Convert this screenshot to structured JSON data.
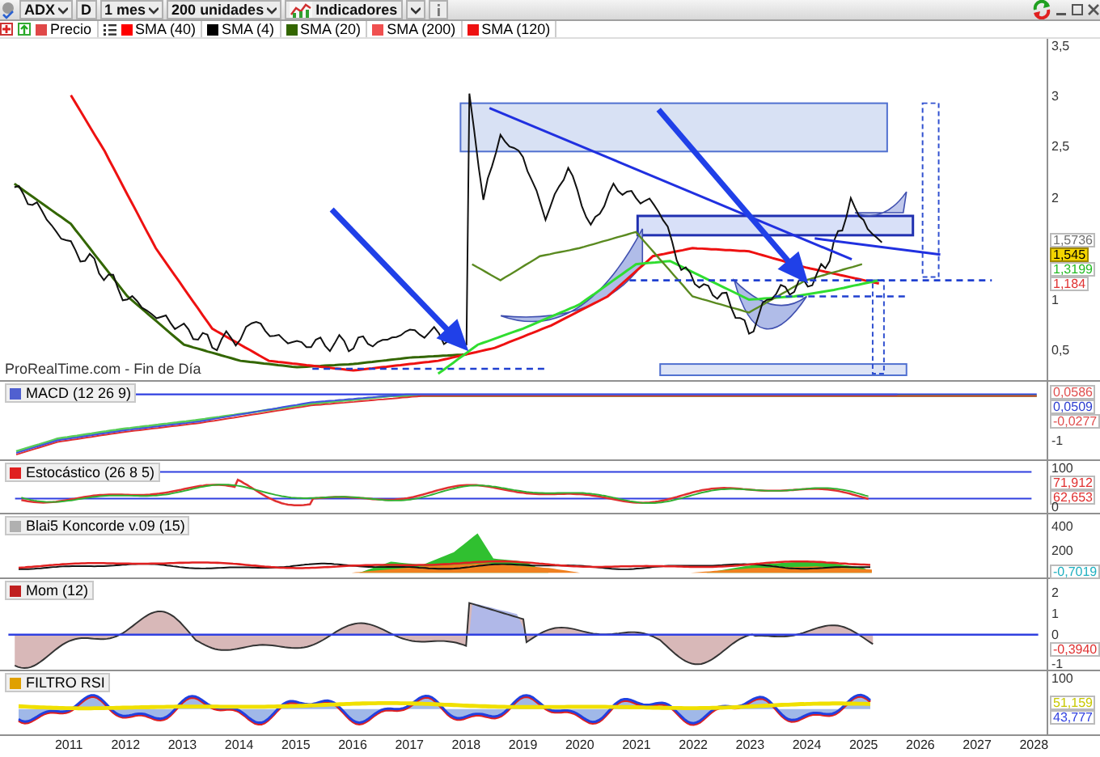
{
  "toolbar": {
    "ticker": "ADX",
    "day_button": "D",
    "period": "1 mes",
    "units": "200 unidades",
    "indicators": "Indicadores"
  },
  "legend": [
    {
      "label": "Precio",
      "color": "#e04848"
    },
    {
      "label": "SMA (40)",
      "color": "#ff0000"
    },
    {
      "label": "SMA (4)",
      "color": "#000000"
    },
    {
      "label": "SMA (20)",
      "color": "#336600"
    },
    {
      "label": "SMA (200)",
      "color": "#f05050"
    },
    {
      "label": "SMA (120)",
      "color": "#ee1111"
    }
  ],
  "main_panel": {
    "source_note": "ProRealTime.com - Fin de Día",
    "ticks": [
      "3,5",
      "3",
      "2,5",
      "2",
      "1",
      "0,5"
    ],
    "value_tags": [
      {
        "text": "1,5736",
        "color": "#707070",
        "highlighted": false
      },
      {
        "text": "1,545",
        "color": "#f3d400",
        "highlighted": true
      },
      {
        "text": "1,3199",
        "color": "#22bb22",
        "highlighted": false
      },
      {
        "text": "1,184",
        "color": "#e03030",
        "highlighted": false
      }
    ]
  },
  "indicator_panels": [
    {
      "kind": "macd",
      "title": "MACD (12 26 9)",
      "color": "#5060d0",
      "ticks": [
        "-1"
      ],
      "value_tags": [
        {
          "text": "0,0586",
          "color": "#e05050",
          "highlighted": false
        },
        {
          "text": "0,0509",
          "color": "#3040d0",
          "highlighted": false
        },
        {
          "text": "-0,0277",
          "color": "#e05050",
          "highlighted": false
        }
      ]
    },
    {
      "kind": "stochastic",
      "title": "Estocástico (26 8 5)",
      "color": "#e02020",
      "ticks": [
        "100",
        "0"
      ],
      "value_tags": [
        {
          "text": "71,912",
          "color": "#e03030",
          "highlighted": false
        },
        {
          "text": "62,653",
          "color": "#e03030",
          "highlighted": false
        }
      ]
    },
    {
      "kind": "koncorde",
      "title": "Blai5 Koncorde v.09 (15)",
      "color": "#b0b0b0",
      "ticks": [
        "400",
        "200"
      ],
      "value_tags": [
        {
          "text": "-0,7019",
          "color": "#20b0c0",
          "highlighted": false
        }
      ]
    },
    {
      "kind": "momentum",
      "title": "Mom (12)",
      "color": "#c02020",
      "ticks": [
        "2",
        "1",
        "0",
        "-1"
      ],
      "value_tags": [
        {
          "text": "-0,3940",
          "color": "#e03030",
          "highlighted": false
        }
      ]
    },
    {
      "kind": "rsi_filter",
      "title": "FILTRO RSI",
      "color": "#e0a000",
      "ticks": [
        "100"
      ],
      "value_tags": [
        {
          "text": "51,159",
          "color": "#c8c800",
          "highlighted": false
        },
        {
          "text": "43,777",
          "color": "#3040e0",
          "highlighted": false
        }
      ]
    }
  ],
  "x_axis": {
    "labels": [
      "2011",
      "2012",
      "2013",
      "2014",
      "2015",
      "2016",
      "2017",
      "2018",
      "2019",
      "2020",
      "2021",
      "2022",
      "2023",
      "2024",
      "2025",
      "2026",
      "2027",
      "2028"
    ]
  }
}
